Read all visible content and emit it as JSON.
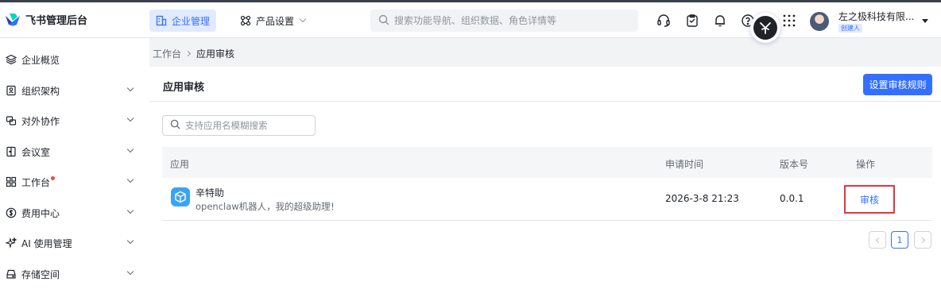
{
  "app": {
    "title": "飞书管理后台"
  },
  "header": {
    "tabs": [
      {
        "label": "企业管理",
        "active": true
      },
      {
        "label": "产品设置",
        "active": false
      }
    ],
    "search_placeholder": "搜索功能导航、组织数据、角色详情等",
    "icons": [
      "headset-icon",
      "clipboard-icon",
      "bell-icon",
      "help-icon",
      "app-grid-icon"
    ],
    "user": {
      "name": "左之极科技有限...",
      "role": "创建人"
    }
  },
  "sidebar": {
    "items": [
      {
        "label": "企业概览",
        "icon": "layers-icon",
        "expandable": false,
        "dot": false
      },
      {
        "label": "组织架构",
        "icon": "contact-card-icon",
        "expandable": true,
        "dot": false
      },
      {
        "label": "对外协作",
        "icon": "collaboration-icon",
        "expandable": true,
        "dot": false
      },
      {
        "label": "会议室",
        "icon": "meeting-room-icon",
        "expandable": true,
        "dot": false
      },
      {
        "label": "工作台",
        "icon": "grid-icon",
        "expandable": true,
        "dot": true
      },
      {
        "label": "费用中心",
        "icon": "dollar-icon",
        "expandable": true,
        "dot": false
      },
      {
        "label": "AI 使用管理",
        "icon": "sparkle-icon",
        "expandable": true,
        "dot": false
      },
      {
        "label": "存储空间",
        "icon": "storage-icon",
        "expandable": true,
        "dot": false
      }
    ]
  },
  "breadcrumb": {
    "parent": "工作台",
    "current": "应用审核"
  },
  "main": {
    "title": "应用审核",
    "primary_button": "设置审核规则",
    "search_placeholder": "支持应用名模糊搜索",
    "table": {
      "headers": [
        "应用",
        "申请时间",
        "版本号",
        "操作"
      ],
      "rows": [
        {
          "name": "辛特助",
          "description": "openclaw机器人，我的超级助理！",
          "time": "2026-3-8 21:23",
          "version": "0.0.1",
          "action": "审核"
        }
      ]
    },
    "pagination": {
      "current": "1"
    }
  },
  "colors": {
    "accent": "#3370ff",
    "highlight": "#e3343f",
    "app_icon": "#3aa3f5"
  }
}
